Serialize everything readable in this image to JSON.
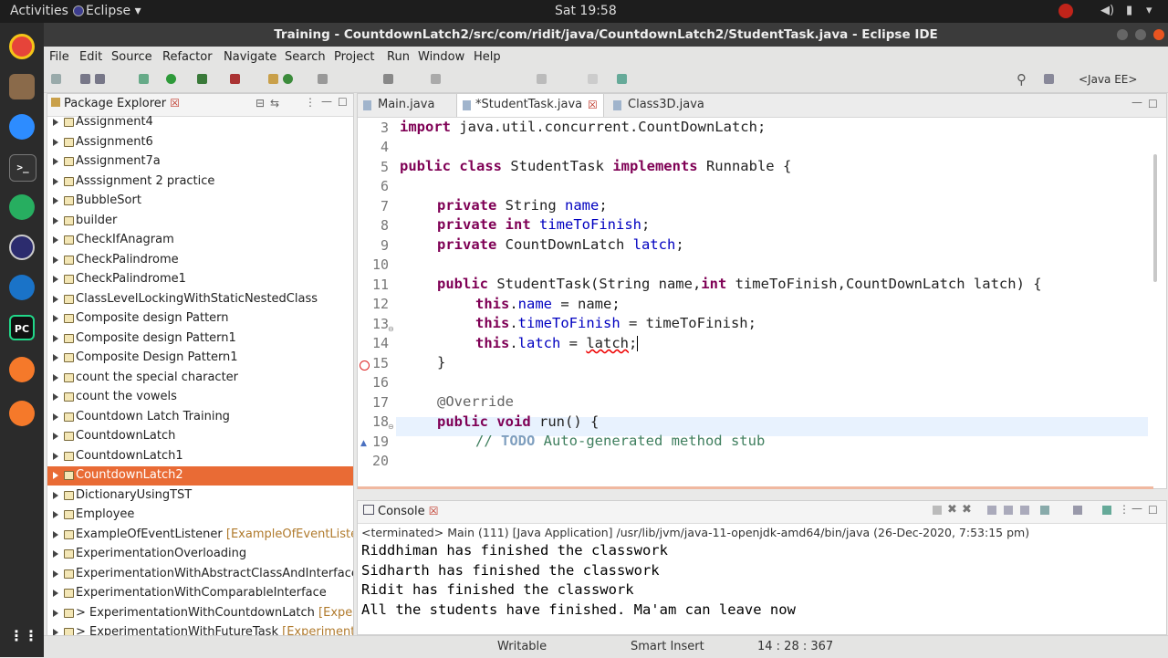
{
  "system": {
    "activities": "Activities",
    "app_name": "Eclipse",
    "clock": "Sat 19:58"
  },
  "window": {
    "title": "Training - CountdownLatch2/src/com/ridit/java/CountdownLatch2/StudentTask.java - Eclipse IDE"
  },
  "menu": [
    "File",
    "Edit",
    "Source",
    "Refactor",
    "Navigate",
    "Search",
    "Project",
    "Run",
    "Window",
    "Help"
  ],
  "toolbar": {
    "perspective": "<Java EE>"
  },
  "package_explorer": {
    "title": "Package Explorer",
    "items": [
      {
        "name": "Assignment4",
        "dec": ""
      },
      {
        "name": "Assignment6",
        "dec": ""
      },
      {
        "name": "Assignment7a",
        "dec": ""
      },
      {
        "name": "Asssignment 2 practice",
        "dec": ""
      },
      {
        "name": "BubbleSort",
        "dec": ""
      },
      {
        "name": "builder",
        "dec": ""
      },
      {
        "name": "CheckIfAnagram",
        "dec": ""
      },
      {
        "name": "CheckPalindrome",
        "dec": ""
      },
      {
        "name": "CheckPalindrome1",
        "dec": ""
      },
      {
        "name": "ClassLevelLockingWithStaticNestedClass",
        "dec": ""
      },
      {
        "name": "Composite design Pattern",
        "dec": ""
      },
      {
        "name": "Composite design Pattern1",
        "dec": ""
      },
      {
        "name": "Composite Design Pattern1",
        "dec": ""
      },
      {
        "name": "count the special character",
        "dec": ""
      },
      {
        "name": "count the vowels",
        "dec": ""
      },
      {
        "name": "Countdown Latch Training",
        "dec": ""
      },
      {
        "name": "CountdownLatch",
        "dec": ""
      },
      {
        "name": "CountdownLatch1",
        "dec": ""
      },
      {
        "name": "CountdownLatch2",
        "dec": ""
      },
      {
        "name": "DictionaryUsingTST",
        "dec": ""
      },
      {
        "name": "Employee",
        "dec": ""
      },
      {
        "name": "ExampleOfEventListener",
        "dec": " [ExampleOfEventListener]"
      },
      {
        "name": "ExperimentationOverloading",
        "dec": ""
      },
      {
        "name": "ExperimentationWithAbstractClassAndInterface",
        "dec": ""
      },
      {
        "name": "ExperimentationWithComparableInterface",
        "dec": ""
      },
      {
        "name": "> ExperimentationWithCountdownLatch",
        "dec": " [ExperimentationWithCountdownLatch]"
      },
      {
        "name": "> ExperimentationWithFutureTask",
        "dec": " [ExperimentationWithFutureTask]"
      }
    ],
    "selected_index": 18
  },
  "editor": {
    "tabs": [
      {
        "label": "Main.java",
        "active": false
      },
      {
        "label": "*StudentTask.java",
        "active": true
      },
      {
        "label": "Class3D.java",
        "active": false
      }
    ],
    "line_numbers": [
      "3",
      "4",
      "5",
      "6",
      "7",
      "8",
      "9",
      "10",
      "11",
      "12",
      "13",
      "14",
      "15",
      "16",
      "17",
      "18",
      "19",
      "20"
    ],
    "code": {
      "l3_kw": "import",
      "l3_rest": " java.util.concurrent.CountDownLatch;",
      "l5_kw1": "public class",
      "l5_mid": " StudentTask ",
      "l5_kw2": "implements",
      "l5_rest": " Runnable {",
      "l7_kw": "private",
      "l7_type": " String ",
      "l7_field": "name",
      "l7_end": ";",
      "l8_kw": "private int",
      "l8_sp": " ",
      "l8_field": "timeToFinish",
      "l8_end": ";",
      "l9_kw": "private",
      "l9_type": " CountDownLatch ",
      "l9_field": "latch",
      "l9_end": ";",
      "l11_kw": "public",
      "l11_a": " StudentTask(String name,",
      "l11_kw2": "int",
      "l11_b": " timeToFinish,CountDownLatch latch) {",
      "l12_kw": "this",
      "l12_dot": ".",
      "l12_field": "name",
      "l12_rest": " = name;",
      "l13_kw": "this",
      "l13_dot": ".",
      "l13_field": "timeToFinish",
      "l13_rest": " = timeToFinish;",
      "l14_kw": "this",
      "l14_dot": ".",
      "l14_field": "latch",
      "l14_eq": " = ",
      "l14_val": "latch",
      "l14_end": ";",
      "l15": "}",
      "l17_ann": "@Override",
      "l18_kw": "public void",
      "l18_rest": " run() {",
      "l19_cm1": "// ",
      "l19_todo": "TODO",
      "l19_cm2": " Auto-generated method stub"
    }
  },
  "console": {
    "title": "Console",
    "status": "<terminated> Main (111) [Java Application] /usr/lib/jvm/java-11-openjdk-amd64/bin/java (26-Dec-2020, 7:53:15 pm)",
    "output": [
      "Riddhiman has finished the classwork",
      "Sidharth has finished the classwork",
      "Ridit has finished the classwork",
      "All the students have finished. Ma'am can leave now"
    ]
  },
  "statusbar": {
    "writable": "Writable",
    "insert_mode": "Smart Insert",
    "position": "14 : 28 : 367"
  },
  "colors": {
    "accent": "#e96b35",
    "keyword": "#7f0055",
    "field": "#0000c0",
    "comment": "#3f7f5f"
  }
}
